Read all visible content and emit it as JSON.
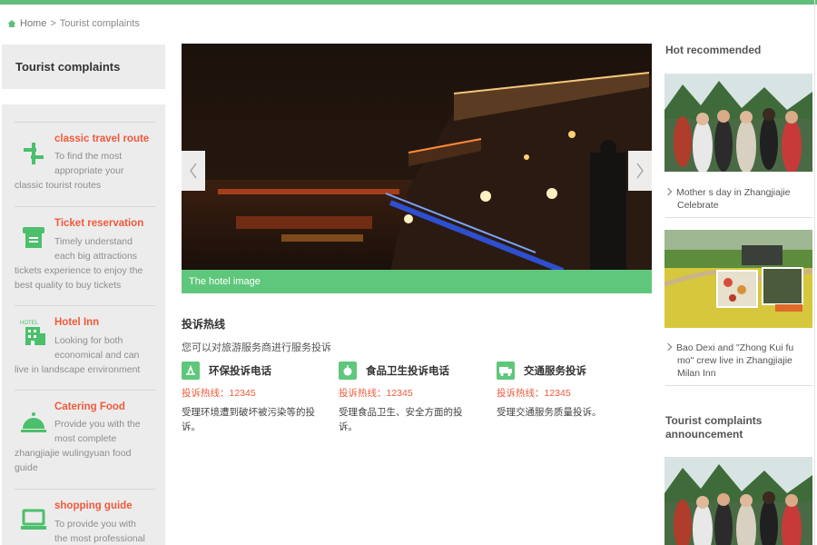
{
  "breadcrumb": {
    "home": "Home",
    "separator": ">",
    "current": "Tourist complaints"
  },
  "sidebar": {
    "title": "Tourist complaints",
    "items": [
      {
        "icon": "route-icon",
        "title": "classic travel route",
        "lines": [
          "To find the most",
          "appropriate your",
          "classic tourist routes"
        ]
      },
      {
        "icon": "ticket-icon",
        "title": "Ticket reservation",
        "lines": [
          "Timely understand",
          "each big attractions",
          "tickets experience to enjoy the",
          "best quality to buy tickets"
        ]
      },
      {
        "icon": "hotel-icon",
        "title": "Hotel Inn",
        "lines": [
          "Looking for both",
          "economical and can",
          "live in landscape environment"
        ]
      },
      {
        "icon": "catering-icon",
        "title": "Catering Food",
        "lines": [
          "Provide you with the",
          "most complete",
          "zhangjiajie wulingyuan food",
          "guide"
        ]
      },
      {
        "icon": "shopping-icon",
        "title": "shopping guide",
        "lines": [
          "To provide you with",
          "the most professional"
        ]
      }
    ]
  },
  "slider": {
    "caption": "The hotel image"
  },
  "hotline": {
    "heading": "投诉热线",
    "subtitle": "您可以对旅游服务商进行服务投诉",
    "cards": [
      {
        "icon": "environment-icon",
        "title": "环保投诉电话",
        "phone": "投诉热线：12345",
        "desc": "受理环境遭到破坏被污染等的投诉。"
      },
      {
        "icon": "food-safety-icon",
        "title": "食品卫生投诉电话",
        "phone": "投诉热线：12345",
        "desc": "受理食品卫生、安全方面的投诉。"
      },
      {
        "icon": "traffic-icon",
        "title": "交通服务投诉",
        "phone": "投诉热线：12345",
        "desc": "受理交通服务质量投诉。"
      }
    ]
  },
  "right": {
    "hot_heading": "Hot recommended",
    "items": [
      {
        "text": "Mother s day in Zhangjiajie Celebrate"
      },
      {
        "text": "Bao Dexi and \"Zhong Kui fu mo\" crew live in Zhangjiajie Milan Inn"
      }
    ],
    "announcement_heading": "Tourist complaints announcement"
  },
  "colors": {
    "accent": "#5fc77b",
    "link_red": "#f05a3c",
    "sidebar_bg": "#ececec"
  }
}
